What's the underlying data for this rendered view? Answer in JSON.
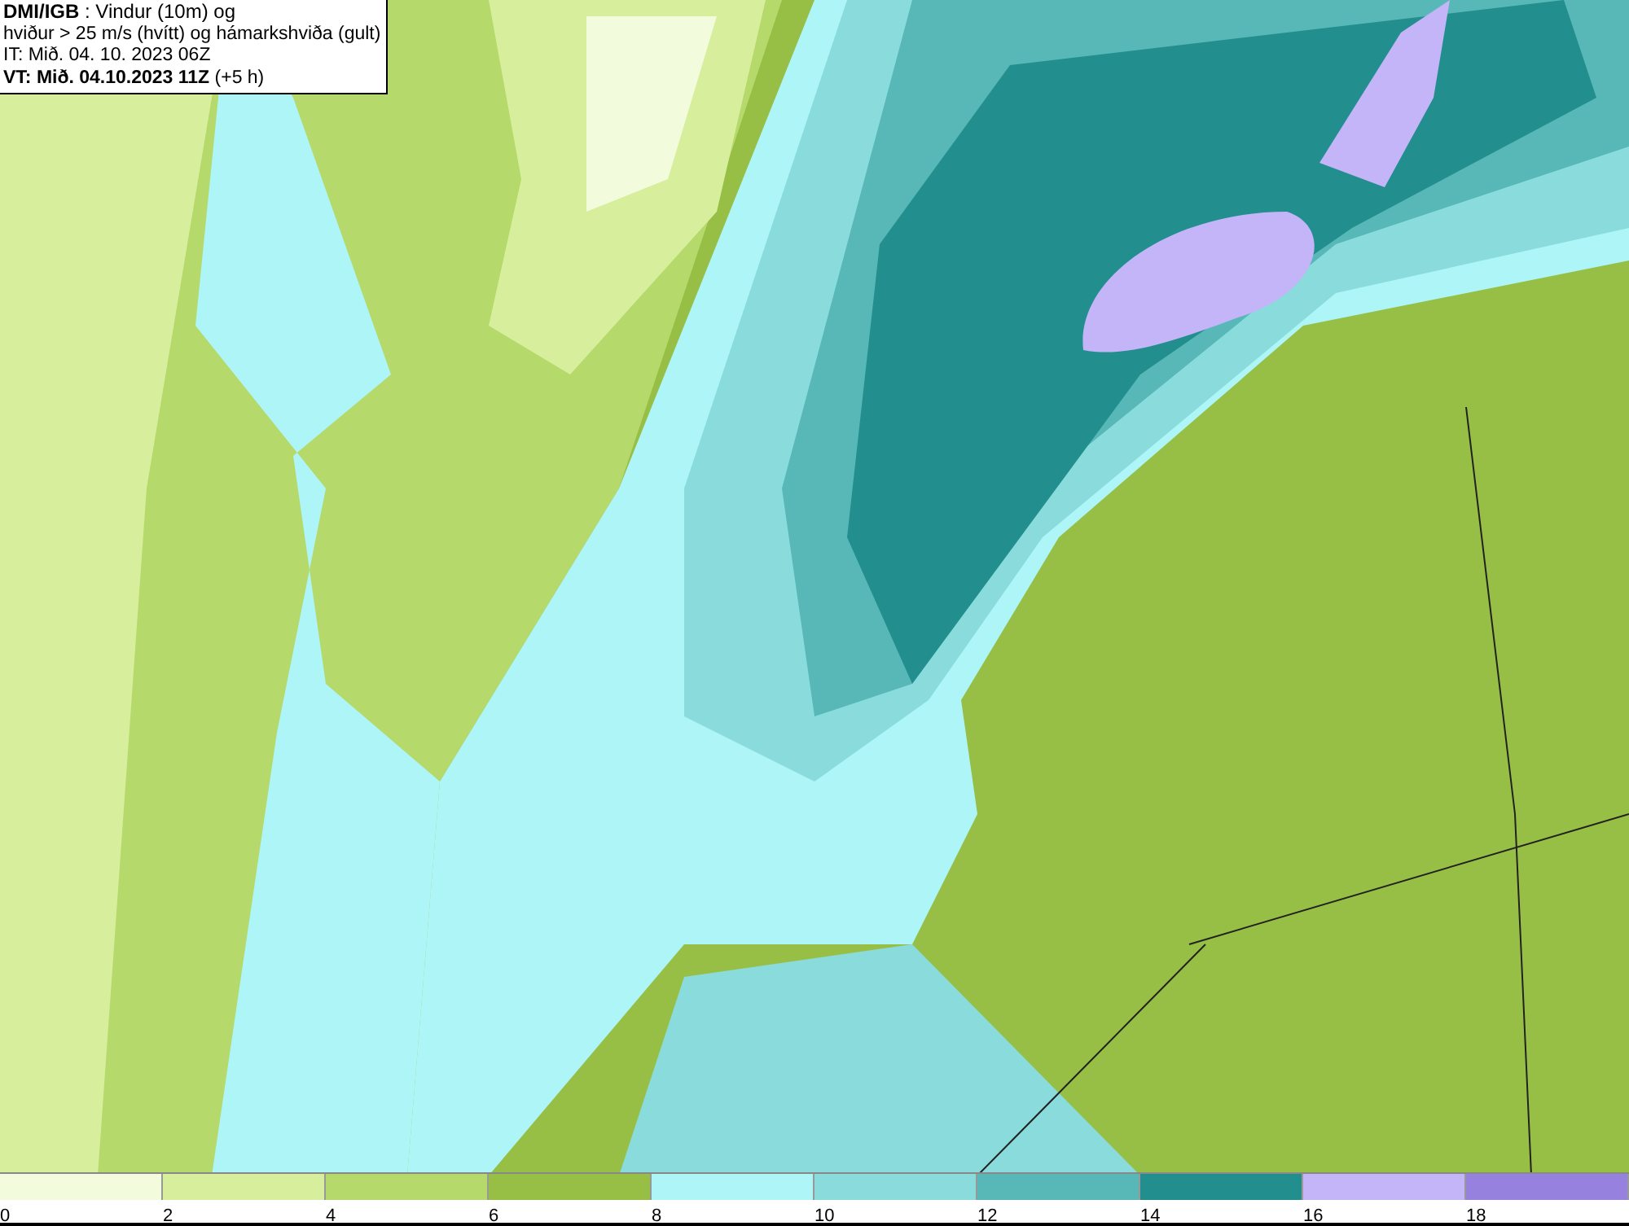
{
  "caption": {
    "lines": [
      "**DMI/IGB** : Vindur (10m) og",
      "hviður > 25 m/s (hvítt) og hámarkshviða (gult)",
      "IT: Mið. 04. 10. 2023 06Z",
      "**VT: Mið. 04.10.2023 11Z** (+5 h)"
    ]
  },
  "legend": [
    {
      "label": "0",
      "color": "#f2fbdc"
    },
    {
      "label": "2",
      "color": "#d7ef9c"
    },
    {
      "label": "4",
      "color": "#b5d96b"
    },
    {
      "label": "6",
      "color": "#98bf45"
    },
    {
      "label": "8",
      "color": "#aef5f7"
    },
    {
      "label": "10",
      "color": "#8adcdc"
    },
    {
      "label": "12",
      "color": "#58b7b7"
    },
    {
      "label": "14",
      "color": "#228f8e"
    },
    {
      "label": "16",
      "color": "#c4b4f8"
    },
    {
      "label": "18",
      "color": "#9781df"
    }
  ]
}
